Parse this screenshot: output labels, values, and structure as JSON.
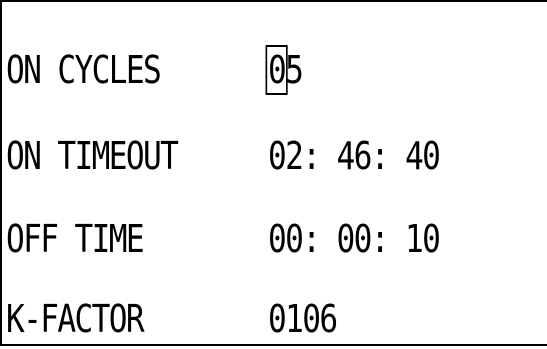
{
  "rows": [
    {
      "label": "ON CYCLES",
      "value_selected_digit": "0",
      "value_rest": "5"
    },
    {
      "label": "ON TIMEOUT",
      "value": "02: 46: 40"
    },
    {
      "label": "OFF TIME",
      "value": "00: 00: 10"
    },
    {
      "label": "K-FACTOR",
      "value": "0106"
    }
  ],
  "colors": {
    "background": "#ffffff",
    "text": "#000000"
  }
}
